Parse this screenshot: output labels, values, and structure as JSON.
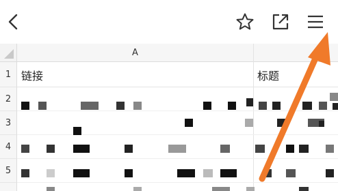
{
  "toolbar": {
    "back_icon": "chevron-left-icon",
    "star_icon": "star-outline-icon",
    "share_icon": "open-external-icon",
    "menu_icon": "hamburger-menu-icon"
  },
  "sheet": {
    "column_a_header": "A",
    "rows": [
      {
        "number": "1",
        "col_a": "链接",
        "col_b": "标题"
      },
      {
        "number": "2",
        "col_a": "",
        "col_b": ""
      },
      {
        "number": "3",
        "col_a": "",
        "col_b": ""
      },
      {
        "number": "4",
        "col_a": "",
        "col_b": ""
      },
      {
        "number": "5",
        "col_a": "",
        "col_b": ""
      }
    ]
  },
  "colors": {
    "arrow": "#f07a2a",
    "icon": "#333333",
    "header_bg": "#f6f6f6"
  }
}
